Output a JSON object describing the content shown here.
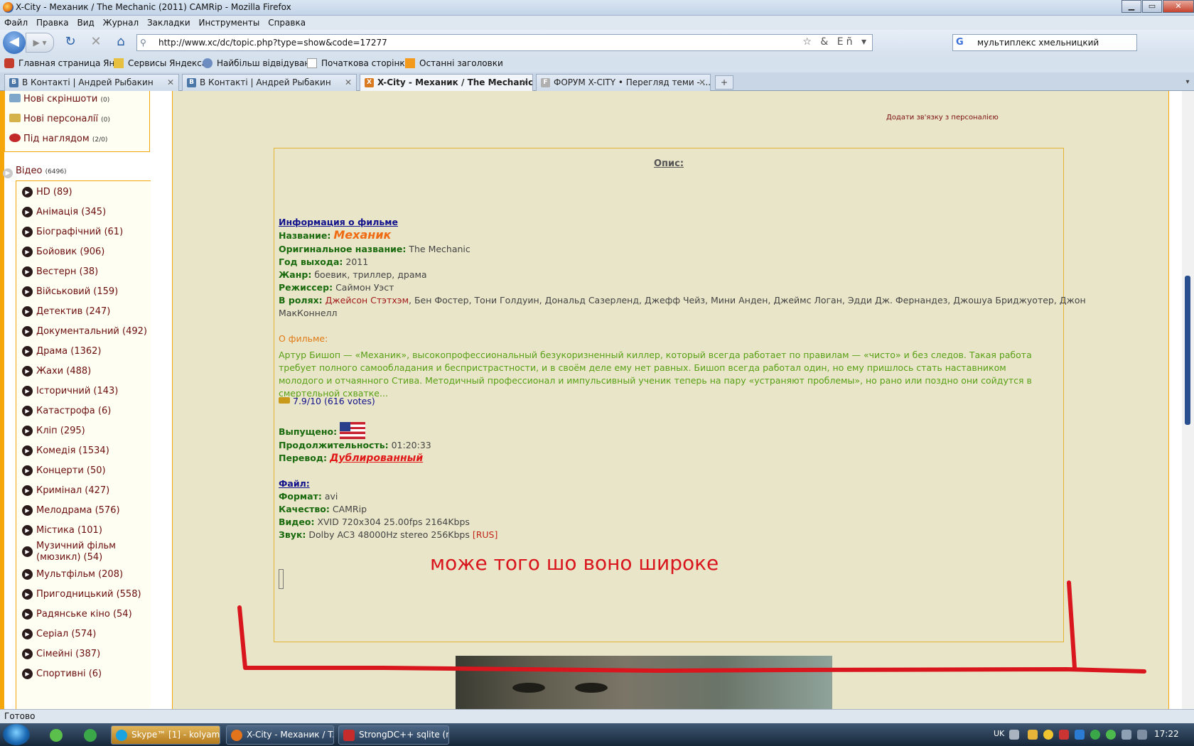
{
  "window": {
    "title": "X-City - Механик / The Mechanic (2011) CAMRip - Mozilla Firefox",
    "buttons": {
      "minimize": "▁",
      "maximize": "▭",
      "close": "✕"
    }
  },
  "menu": [
    "Файл",
    "Правка",
    "Вид",
    "Журнал",
    "Закладки",
    "Инструменты",
    "Справка"
  ],
  "nav": {
    "back_icon": "arrow-left",
    "forward_icon": "arrow-right",
    "url": "http://www.xc/dc/topic.php?type=show&code=17277",
    "search_query": "мультиплекс хмельницкий",
    "search_engine_letter": "G",
    "star_icons": "☆ & Eñ ▾"
  },
  "bookmarks": [
    "Главная страница Ян...",
    "Сервисы Яндекса",
    "Найбільш відвідувані",
    "Початкова сторінка",
    "Останні заголовки"
  ],
  "tabs": [
    {
      "label": "В Контакті | Андрей Рыбакин",
      "active": false,
      "icon": "B"
    },
    {
      "label": "В Контакті | Андрей Рыбакин",
      "active": false,
      "icon": "B"
    },
    {
      "label": "X-City - Механик / The Mechanic...",
      "active": true,
      "icon": "X"
    },
    {
      "label": "ФОРУМ X-CITY • Перегляд теми - ...",
      "active": false,
      "icon": "F"
    }
  ],
  "sidebar": {
    "top_items": [
      {
        "label": "Нові скріншоти",
        "count": "(0)"
      },
      {
        "label": "Нові персоналії",
        "count": "(0)"
      },
      {
        "label": "Під наглядом",
        "count": "(2/0)"
      }
    ],
    "video_header": {
      "label": "Відео",
      "count": "(6496)"
    },
    "categories": [
      "HD (89)",
      "Анімація (345)",
      "Біографічний (61)",
      "Бойовик (906)",
      "Вестерн (38)",
      "Військовий (159)",
      "Детектив (247)",
      "Документальний (492)",
      "Драма (1362)",
      "Жахи (488)",
      "Історичний (143)",
      "Катастрофа (6)",
      "Кліп (295)",
      "Комедія (1534)",
      "Концерти (50)",
      "Кримінал (427)",
      "Мелодрама (576)",
      "Містика (101)",
      "Музичний фільм (мюзикл) (54)",
      "Мультфільм (208)",
      "Пригодницький (558)",
      "Радянське кіно (54)",
      "Серіал (574)",
      "Сімейні (387)",
      "Спортивні (6)"
    ]
  },
  "content": {
    "add_link": "Додати зв'язку з персоналією",
    "opys_title": "Опис:",
    "info_header": "Информация о фильме",
    "name_label": "Название:",
    "name_value": "Механик",
    "orig_label": "Оригинальное название:",
    "orig_value": "The Mechanic",
    "year_label": "Год выхода:",
    "year_value": "2011",
    "genre_label": "Жанр:",
    "genre_value": "боевик, триллер, драма",
    "director_label": "Режиссер:",
    "director_value": "Саймон Уэст",
    "cast_label": "В ролях:",
    "cast_main": "Джейсон Стэтхэм",
    "cast_rest": ", Бен Фостер, Тони Голдуин, Дональд Сазерленд, Джефф Чейз, Мини Анден, Джеймс Логан, Эдди Дж. Фернандез, Джошуа Бриджуотер, Джон",
    "cast_rest2": "МакКоннелл",
    "about_label": "О фильме:",
    "description": "Артур Бишоп — «Механик», высокопрофессиональный безукоризненный киллер, который всегда работает по правилам — «чисто» и без следов. Такая работа требует полного самообладания и беспристрастности, и в своём деле ему нет равных. Бишоп всегда работал один, но ему пришлось стать наставником молодого и отчаянного Стива. Методичный профессионал и импульсивный ученик теперь на пару «устраняют проблемы», но рано или поздно они сойдутся в смертельной схватке...",
    "rating": "7.9/10 (616 votes)",
    "released_label": "Выпущено:",
    "duration_label": "Продолжительность:",
    "duration_value": "01:20:33",
    "translation_label": "Перевод:",
    "translation_value": "Дублированный",
    "file_header": "Файл:",
    "format_label": "Формат:",
    "format_value": "avi",
    "quality_label": "Качество:",
    "quality_value": "CAMRip",
    "video_label": "Видео:",
    "video_value": "XVID 720x304 25.00fps 2164Kbps",
    "audio_label": "Звук:",
    "audio_value": "Dolby AC3 48000Hz stereo 256Kbps",
    "audio_lang": "[RUS]",
    "annotation": "може того шо воно широке"
  },
  "status": "Готово",
  "taskbar": {
    "tasks": [
      {
        "label": "Skype™ [1] - kolyamel",
        "active": true
      },
      {
        "label": "X-City - Механик / T...",
        "active": false
      },
      {
        "label": "StrongDC++ sqlite (r...",
        "active": false
      }
    ],
    "lang": "UK",
    "clock": "17:22"
  },
  "colors": {
    "accent_orange": "#f5a60a",
    "annotation_red": "#d9151d",
    "page_bg": "#e9e5c8"
  }
}
